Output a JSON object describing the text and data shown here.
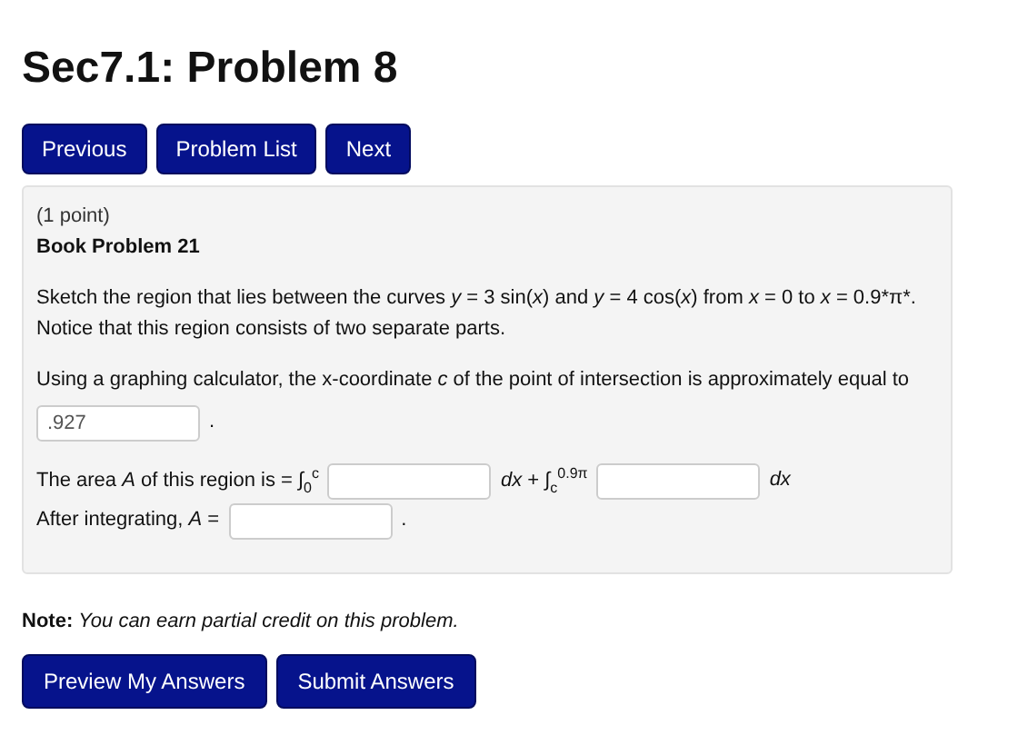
{
  "title": "Sec7.1: Problem 8",
  "nav_buttons": [
    "Previous",
    "Problem List",
    "Next"
  ],
  "problem": {
    "points": "(1 point)",
    "heading": "Book Problem 21",
    "statement": "Sketch the region that lies between the curves *y* = 3 sin(*x*) and *y* = 4 cos(*x*) from *x* = 0 to *x* = 0.9*π*. Notice that this region consists of two separate parts.",
    "lines": [
      {
        "parts": [
          {
            "kind": "text",
            "text": "Using a graphing calculator, the x-coordinate *c* of the point of intersection is approximately equal to"
          },
          {
            "kind": "input",
            "value": ".927"
          },
          {
            "kind": "text",
            "text": "."
          }
        ]
      },
      {
        "parts": [
          {
            "kind": "text",
            "text": "The area *A* of this region is = ∫$_{0}$$^{c}$"
          },
          {
            "kind": "input"
          },
          {
            "kind": "text",
            "text": "*dx* + ∫$_{c}$$^{0.9π}$"
          },
          {
            "kind": "input"
          },
          {
            "kind": "text",
            "text": "*dx*"
          }
        ]
      },
      {
        "parts": [
          {
            "kind": "text",
            "text": "After integrating, *A* ="
          },
          {
            "kind": "input"
          },
          {
            "kind": "text",
            "text": "."
          }
        ]
      }
    ]
  },
  "note": {
    "label": "Note:",
    "text": "You can earn partial credit on this problem."
  },
  "action_buttons": [
    "Preview My Answers",
    "Submit Answers"
  ]
}
